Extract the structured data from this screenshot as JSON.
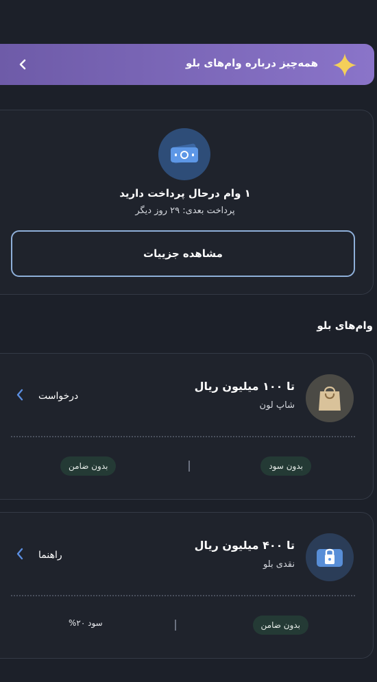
{
  "banner": {
    "title": "همه‌چیز درباره وام‌های بلو",
    "star_icon": "sparkle-icon",
    "back_icon": "chevron-left-icon"
  },
  "status": {
    "icon": "loan-money-icon",
    "title": "۱ وام درحال پرداخت دارید",
    "subtitle": "پرداخت بعدی: ۲۹ روز دیگر",
    "details_button": "مشاهده جزییات"
  },
  "section_title": "وام‌های بلو",
  "loans": [
    {
      "amount": "تا ۱۰۰ میلیون ریال",
      "type": "شاپ لون",
      "icon": "shopping-bag-icon",
      "action": "درخواست",
      "features": [
        "بدون سود",
        "بدون ضامن"
      ]
    },
    {
      "amount": "تا ۴۰۰ میلیون ریال",
      "type": "نقدی بلو",
      "icon": "lock-wallet-icon",
      "action": "راهنما",
      "features": [
        "بدون ضامن",
        "سود ۲۰%"
      ]
    }
  ],
  "colors": {
    "background": "#1c2029",
    "banner": "#8a74c9",
    "accent_blue": "#5b8ee0",
    "pill": "#243a35"
  }
}
